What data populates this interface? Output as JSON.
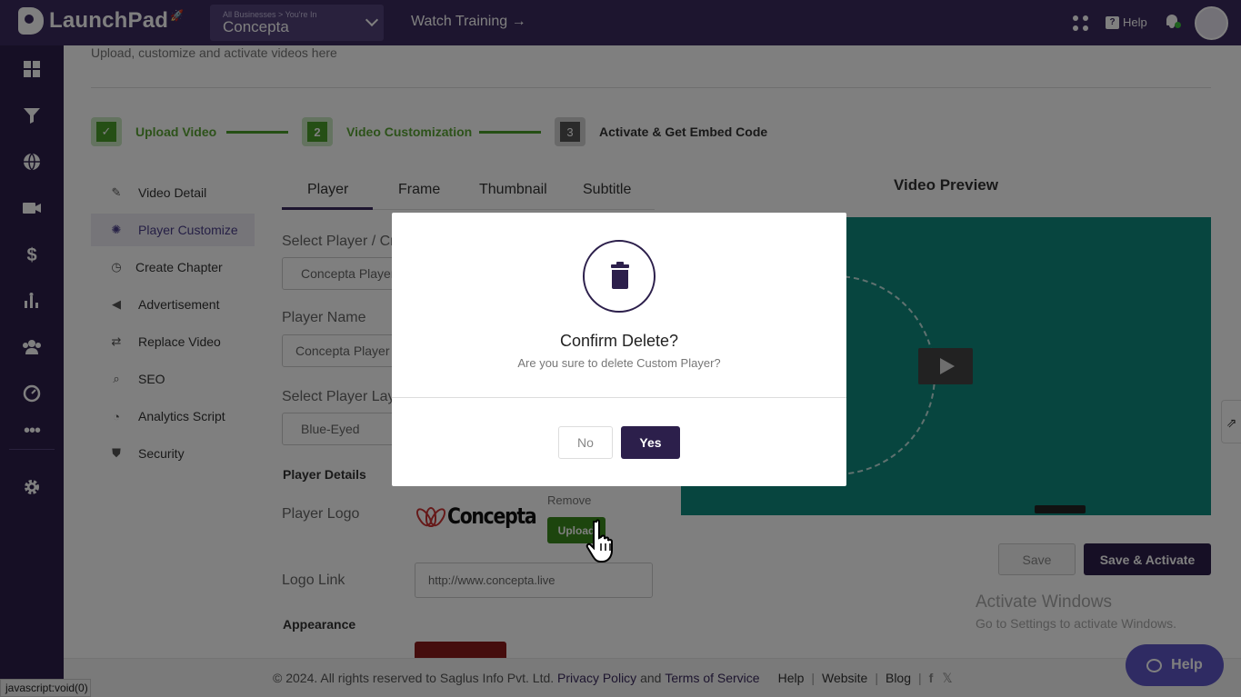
{
  "app": {
    "name": "LaunchPad"
  },
  "header": {
    "business_crumb": "All Businesses > You're In",
    "business_name": "Concepta",
    "watch_training": "Watch Training →",
    "help_label": "Help",
    "help_badge": "?"
  },
  "page": {
    "subtitle": "Upload, customize and activate videos here"
  },
  "steps": [
    {
      "number": "✓",
      "label": "Upload Video",
      "state": "done"
    },
    {
      "number": "2",
      "label": "Video Customization",
      "state": "done"
    },
    {
      "number": "3",
      "label": "Activate & Get Embed Code",
      "state": "pending"
    }
  ],
  "menu": [
    {
      "label": "Video Detail",
      "icon": "edit-icon"
    },
    {
      "label": "Player Customize",
      "icon": "palette-icon",
      "active": true
    },
    {
      "label": "Create Chapter",
      "icon": "stopwatch-icon"
    },
    {
      "label": "Advertisement",
      "icon": "megaphone-icon"
    },
    {
      "label": "Replace Video",
      "icon": "swap-icon"
    },
    {
      "label": "SEO",
      "icon": "search-icon"
    },
    {
      "label": "Analytics Script",
      "icon": "chart-icon"
    },
    {
      "label": "Security",
      "icon": "shield-icon"
    }
  ],
  "tabs": [
    "Player",
    "Frame",
    "Thumbnail",
    "Subtitle"
  ],
  "form": {
    "select_player_label": "Select Player / Cr",
    "select_player_value": "Concepta Player",
    "player_name_label": "Player Name",
    "player_name_value": "Concepta Player",
    "select_layout_label": "Select Player Lay",
    "select_layout_value": "Blue-Eyed",
    "player_details_label": "Player Details",
    "player_logo_label": "Player Logo",
    "logo_word": "Concepta",
    "remove_label": "Remove",
    "upload_label": "Upload",
    "logo_link_label": "Logo Link",
    "logo_link_value": "http://www.concepta.live",
    "appearance_label": "Appearance"
  },
  "preview": {
    "title": "Video Preview"
  },
  "actions": {
    "save": "Save",
    "save_activate": "Save & Activate"
  },
  "windows_watermark": {
    "line1": "Activate Windows",
    "line2": "Go to Settings to activate Windows."
  },
  "footer": {
    "copyright": "©  2024. All rights reserved to Saglus Info Pvt. Ltd.",
    "privacy": "Privacy Policy",
    "and": "and",
    "terms": "Terms of Service",
    "help": "Help",
    "website": "Website",
    "blog": "Blog",
    "facebook": "f",
    "x": "𝕏"
  },
  "help_float": "Help",
  "status_bar": "javascript:void(0)",
  "modal": {
    "title": "Confirm Delete?",
    "message": "Are you sure to delete Custom Player?",
    "no": "No",
    "yes": "Yes"
  },
  "colors": {
    "brand": "#3b2a5e",
    "sidebar": "#2c1f4b",
    "success": "#4a9e2a",
    "help_float": "#5e57c7"
  }
}
